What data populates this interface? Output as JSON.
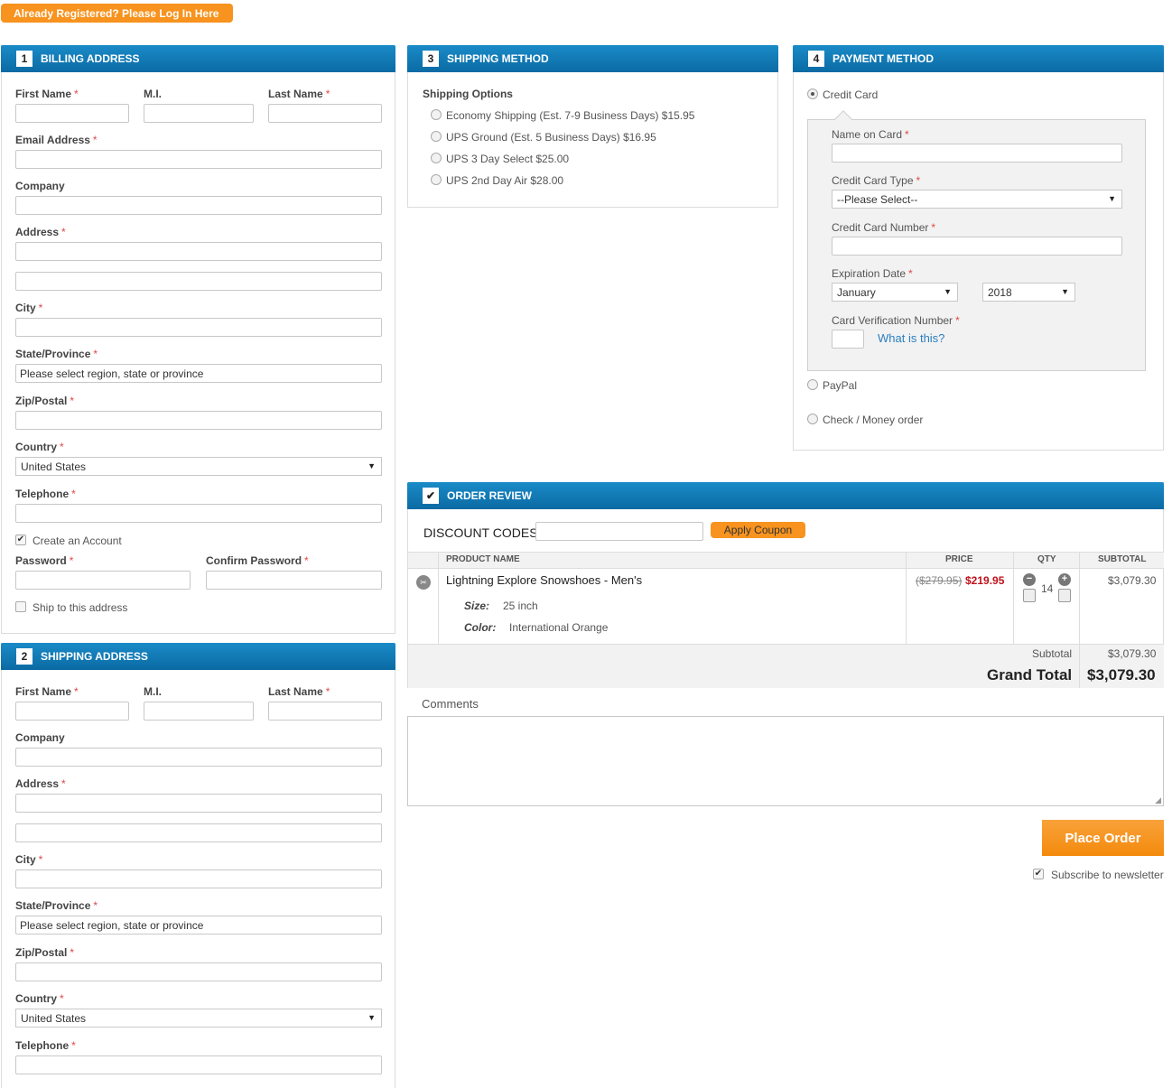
{
  "login_button": "Already Registered? Please Log In Here",
  "billing": {
    "step": "1",
    "title": "BILLING ADDRESS",
    "first_name": "First Name",
    "mi": "M.I.",
    "last_name": "Last Name",
    "email": "Email Address",
    "company": "Company",
    "address": "Address",
    "city": "City",
    "state": "State/Province",
    "state_value": "Please select region, state or province",
    "zip": "Zip/Postal",
    "country": "Country",
    "country_value": "United States",
    "telephone": "Telephone",
    "create_account": "Create an Account",
    "password": "Password",
    "confirm_password": "Confirm Password",
    "ship_to": "Ship to this address"
  },
  "shipping_address": {
    "step": "2",
    "title": "SHIPPING ADDRESS",
    "first_name": "First Name",
    "mi": "M.I.",
    "last_name": "Last Name",
    "company": "Company",
    "address": "Address",
    "city": "City",
    "state": "State/Province",
    "state_value": "Please select region, state or province",
    "zip": "Zip/Postal",
    "country": "Country",
    "country_value": "United States",
    "telephone": "Telephone"
  },
  "shipping_method": {
    "step": "3",
    "title": "SHIPPING METHOD",
    "options_label": "Shipping Options",
    "options": [
      "Economy Shipping (Est. 7-9 Business Days) $15.95",
      "UPS Ground (Est. 5 Business Days) $16.95",
      "UPS 3 Day Select $25.00",
      "UPS 2nd Day Air $28.00"
    ]
  },
  "payment": {
    "step": "4",
    "title": "PAYMENT METHOD",
    "credit_card": "Credit Card",
    "name_on_card": "Name on Card",
    "card_type": "Credit Card Type",
    "card_type_value": "--Please Select--",
    "card_number": "Credit Card Number",
    "expiration": "Expiration Date",
    "month_value": "January",
    "year_value": "2018",
    "cvv": "Card Verification Number",
    "what_is_this": "What is this?",
    "paypal": "PayPal",
    "check": "Check / Money order"
  },
  "review": {
    "title": "ORDER REVIEW",
    "discount_label": "DISCOUNT CODES",
    "apply_coupon": "Apply Coupon",
    "headers": {
      "product": "PRODUCT NAME",
      "price": "PRICE",
      "qty": "QTY",
      "subtotal": "SUBTOTAL"
    },
    "item": {
      "name": "Lightning Explore Snowshoes - Men's",
      "size_label": "Size:",
      "size_value": "25 inch",
      "color_label": "Color:",
      "color_value": "International Orange",
      "old_price": "($279.95)",
      "price": "$219.95",
      "qty": "14",
      "subtotal": "$3,079.30"
    },
    "subtotal_label": "Subtotal",
    "subtotal_value": "$3,079.30",
    "grand_total_label": "Grand Total",
    "grand_total_value": "$3,079.30"
  },
  "comments_label": "Comments",
  "place_order": "Place Order",
  "subscribe": "Subscribe to newsletter"
}
